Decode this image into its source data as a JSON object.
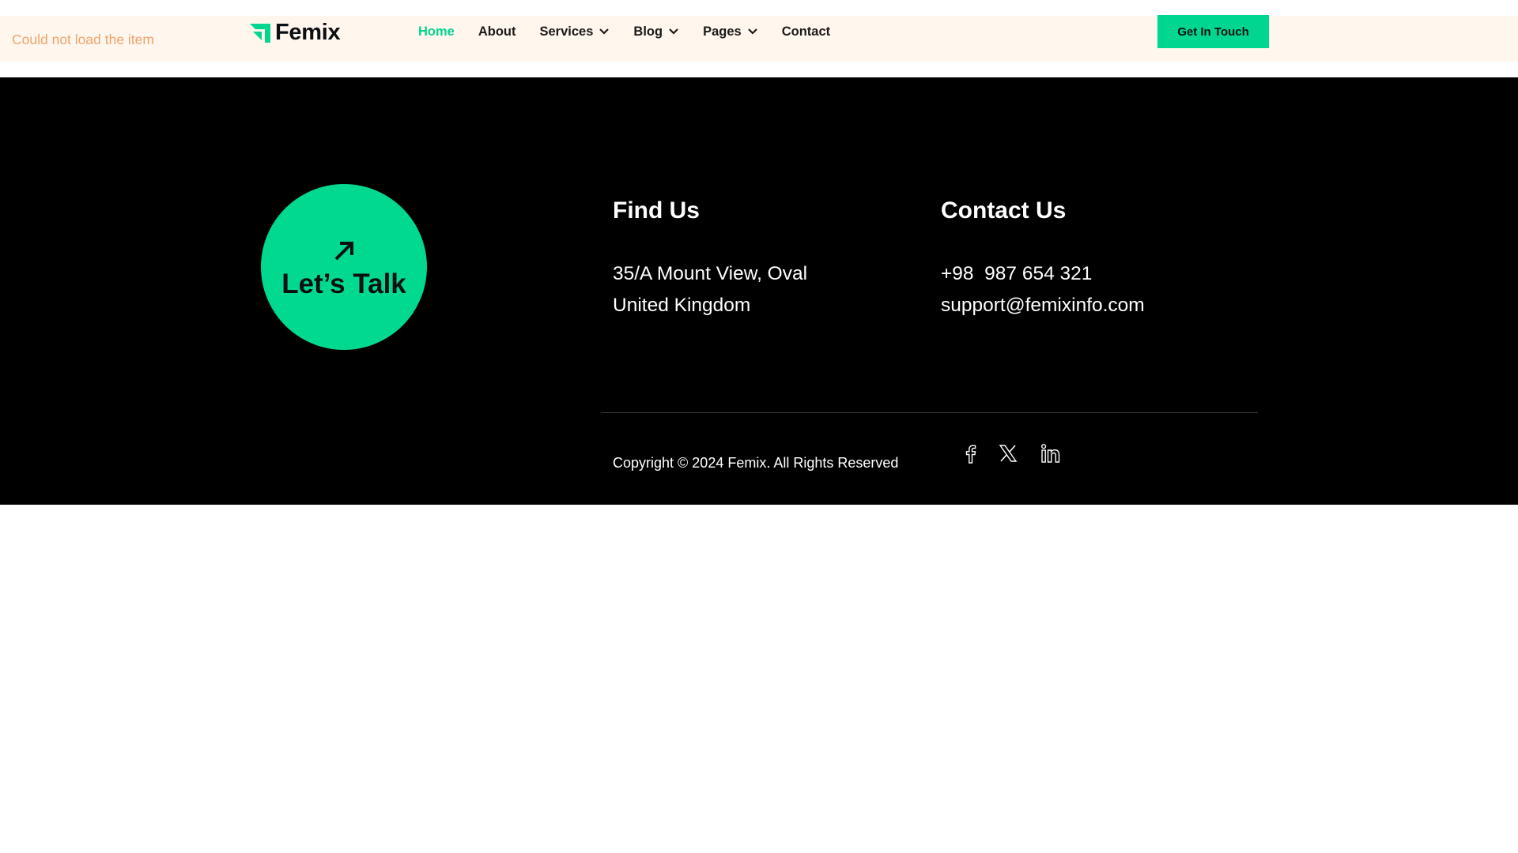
{
  "status": {
    "error_message": "Could not load the item"
  },
  "header": {
    "logo_text": "Femix",
    "nav": [
      {
        "label": "Home",
        "active": true,
        "dropdown": false
      },
      {
        "label": "About",
        "active": false,
        "dropdown": false
      },
      {
        "label": "Services",
        "active": false,
        "dropdown": true
      },
      {
        "label": "Blog",
        "active": false,
        "dropdown": true
      },
      {
        "label": "Pages",
        "active": false,
        "dropdown": true
      },
      {
        "label": "Contact",
        "active": false,
        "dropdown": false
      }
    ],
    "cta_label": "Get In Touch"
  },
  "footer": {
    "talk_label": "Let’s Talk",
    "find_us": {
      "title": "Find Us",
      "line1": "35/A Mount View, Oval",
      "line2": "United Kingdom"
    },
    "contact_us": {
      "title": "Contact Us",
      "phone": "+98  987 654 321",
      "email": "support@femixinfo.com"
    },
    "copyright": "Copyright © 2024 Femix. All Rights Reserved",
    "social": [
      "facebook-icon",
      "x-twitter-icon",
      "linkedin-icon"
    ]
  },
  "colors": {
    "accent": "#00d68f",
    "header_bg": "#fff6ee",
    "footer_bg": "#000000",
    "error_text": "#f0a36a"
  }
}
